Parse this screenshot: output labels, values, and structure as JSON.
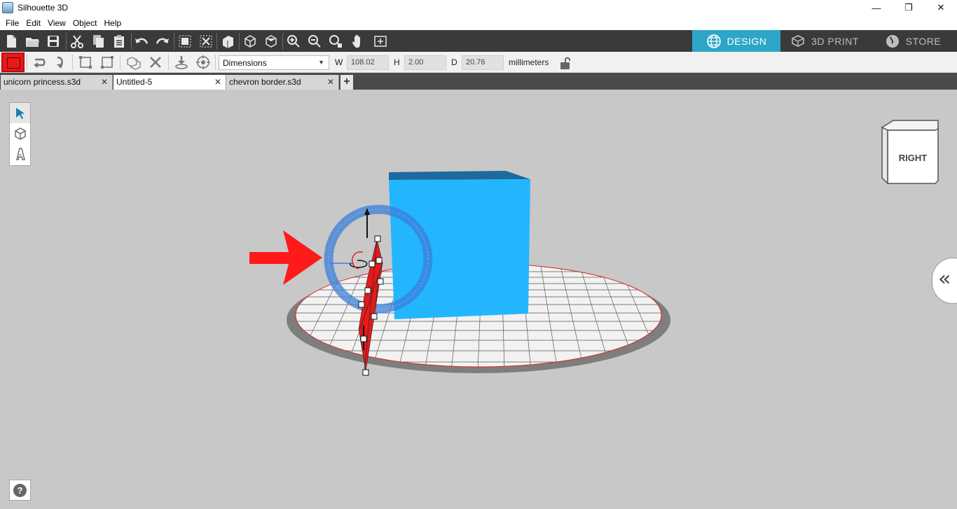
{
  "window": {
    "title": "Silhouette 3D",
    "minimize_glyph": "—",
    "restore_glyph": "❐",
    "close_glyph": "✕"
  },
  "menu": [
    "File",
    "Edit",
    "View",
    "Object",
    "Help"
  ],
  "modes": [
    {
      "label": "DESIGN",
      "icon": "globe-icon",
      "active": true
    },
    {
      "label": "3D PRINT",
      "icon": "print-icon",
      "active": false
    },
    {
      "label": "STORE",
      "icon": "store-icon",
      "active": false
    }
  ],
  "dimensions": {
    "mode_select": "Dimensions",
    "w_label": "W",
    "w_value": "108.02",
    "h_label": "H",
    "h_value": "2.00",
    "d_label": "D",
    "d_value": "20.76",
    "units": "millimeters"
  },
  "object_color": "#e31b1b",
  "accent_color": "#2ba6c7",
  "tabs": [
    {
      "label": "unicorn princess.s3d",
      "active": false
    },
    {
      "label": "Untitled-5",
      "active": true
    },
    {
      "label": "chevron border.s3d",
      "active": false
    }
  ],
  "tab_add_label": "+",
  "tab_close_glyph": "✕",
  "view_cube": {
    "label": "RIGHT"
  },
  "help_label": "?",
  "collapse_glyph": "«"
}
